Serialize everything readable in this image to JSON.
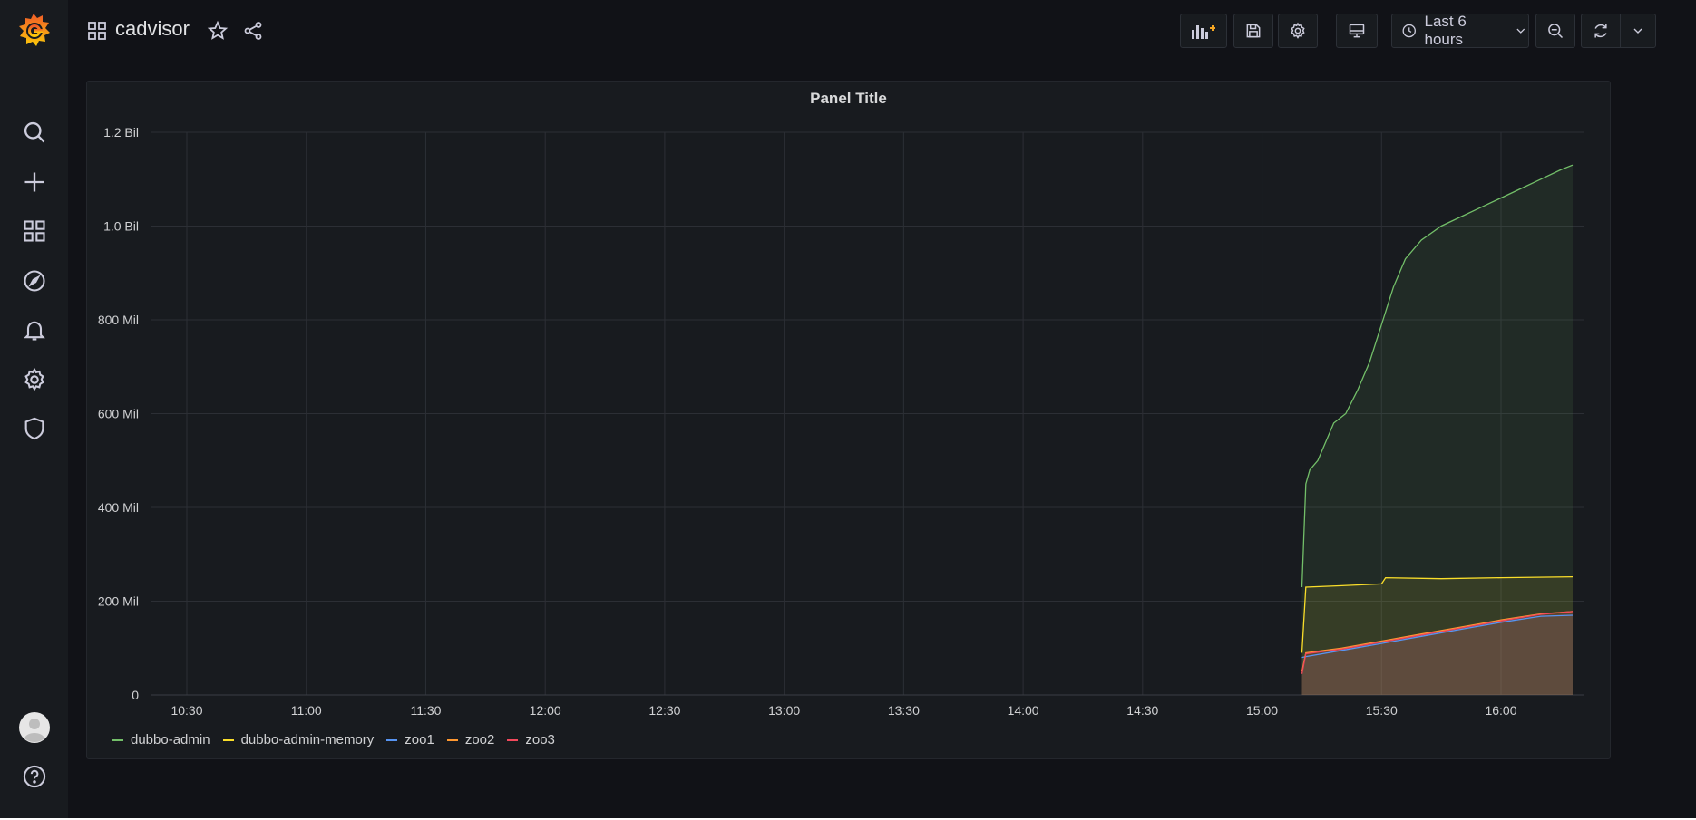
{
  "header": {
    "dashboard_title": "cadvisor",
    "time_range_label": "Last 6 hours"
  },
  "sidebar": {
    "items": [
      "search",
      "create",
      "dashboards",
      "explore",
      "alerting",
      "configuration",
      "server-admin"
    ]
  },
  "panel": {
    "title": "Panel Title"
  },
  "colors": {
    "dubbo-admin": "#73bf69",
    "dubbo-admin-memory": "#fade2a",
    "zoo1": "#5794f2",
    "zoo2": "#ff9830",
    "zoo3": "#f2495c"
  },
  "chart_data": {
    "type": "area",
    "title": "Panel Title",
    "xlabel": "",
    "ylabel": "",
    "x_ticks": [
      "10:30",
      "11:00",
      "11:30",
      "12:00",
      "12:30",
      "13:00",
      "13:30",
      "14:00",
      "14:30",
      "15:00",
      "15:30",
      "16:00"
    ],
    "y_ticks": [
      "0",
      "200 Mil",
      "400 Mil",
      "600 Mil",
      "800 Mil",
      "1.0 Bil",
      "1.2 Bil"
    ],
    "xlim_minutes": [
      "10:17",
      "16:18"
    ],
    "ylim": [
      0,
      1200000000
    ],
    "grid": true,
    "legend_position": "bottom-left",
    "series": [
      {
        "name": "dubbo-admin",
        "x": [
          "15:10",
          "15:11",
          "15:12",
          "15:14",
          "15:16",
          "15:18",
          "15:21",
          "15:24",
          "15:27",
          "15:30",
          "15:33",
          "15:36",
          "15:40",
          "15:45",
          "15:50",
          "15:55",
          "16:00",
          "16:05",
          "16:10",
          "16:15",
          "16:18"
        ],
        "values": [
          230000000,
          450000000,
          480000000,
          500000000,
          540000000,
          580000000,
          600000000,
          650000000,
          710000000,
          790000000,
          870000000,
          930000000,
          970000000,
          1000000000,
          1020000000,
          1040000000,
          1060000000,
          1080000000,
          1100000000,
          1120000000,
          1130000000
        ]
      },
      {
        "name": "dubbo-admin-memory",
        "x": [
          "15:10",
          "15:11",
          "15:20",
          "15:30",
          "15:31",
          "15:45",
          "16:00",
          "16:18"
        ],
        "values": [
          90000000,
          230000000,
          233000000,
          237000000,
          250000000,
          248000000,
          250000000,
          252000000
        ]
      },
      {
        "name": "zoo1",
        "x": [
          "15:10",
          "15:11",
          "15:20",
          "15:30",
          "15:40",
          "15:50",
          "16:00",
          "16:10",
          "16:18"
        ],
        "values": [
          80000000,
          82000000,
          95000000,
          110000000,
          125000000,
          140000000,
          155000000,
          168000000,
          170000000
        ]
      },
      {
        "name": "zoo2",
        "x": [
          "15:10",
          "15:11",
          "15:20",
          "15:30",
          "15:40",
          "15:50",
          "16:00",
          "16:10",
          "16:18"
        ],
        "values": [
          50000000,
          90000000,
          100000000,
          115000000,
          130000000,
          145000000,
          160000000,
          173000000,
          178000000
        ]
      },
      {
        "name": "zoo3",
        "x": [
          "15:10",
          "15:11",
          "15:20",
          "15:30",
          "15:40",
          "15:50",
          "16:00",
          "16:10",
          "16:18"
        ],
        "values": [
          45000000,
          88000000,
          98000000,
          113000000,
          128000000,
          143000000,
          158000000,
          172000000,
          178000000
        ]
      }
    ]
  }
}
